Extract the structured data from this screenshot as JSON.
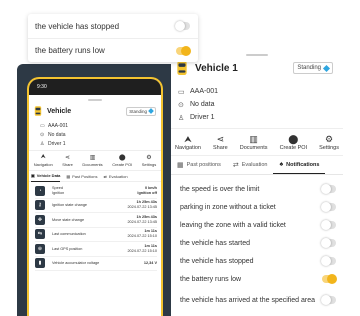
{
  "floating_card": {
    "items": [
      {
        "label": "the vehicle has stopped",
        "on": false
      },
      {
        "label": "the battery runs low",
        "on": true
      }
    ]
  },
  "phone": {
    "status_time": "9:30",
    "title": "Vehicle",
    "badge": "Standing",
    "info": [
      "AAA-001",
      "No data",
      "Driver 1"
    ],
    "actions": [
      {
        "label": "Navigation",
        "icon": "navigation-icon",
        "glyph": "⮝"
      },
      {
        "label": "Share",
        "icon": "share-icon",
        "glyph": "⋖"
      },
      {
        "label": "Documents",
        "icon": "documents-icon",
        "glyph": "▥"
      },
      {
        "label": "Create POI",
        "icon": "location-pin-icon",
        "glyph": "⬤"
      },
      {
        "label": "Settings",
        "icon": "gear-icon",
        "glyph": "⚙"
      }
    ],
    "tabs": [
      "Vehicle Data",
      "Past Positions",
      "Evaluation"
    ],
    "rows": [
      {
        "label": "Speed\nIgnition",
        "value1": "0 km/h",
        "value2": "Ignition off"
      },
      {
        "label": "Ignition state change",
        "value1": "1h 25m 43s",
        "value2": "2024.07.22 13:45"
      },
      {
        "label": "Move state change",
        "value1": "1h 25m 43s",
        "value2": "2024.07.22 13:45"
      },
      {
        "label": "Last communication",
        "value1": "1m 11s",
        "value2": "2024.07.22 15:10"
      },
      {
        "label": "Last GPS position",
        "value1": "1m 11s",
        "value2": "2024.07.22 15:10"
      },
      {
        "label": "Vehicle accumulator voltage",
        "value1": "12,34 V",
        "value2": ""
      }
    ]
  },
  "panel": {
    "title": "Vehicle 1",
    "badge": "Standing",
    "info": [
      "AAA-001",
      "No data",
      "Driver 1"
    ],
    "actions": [
      {
        "label": "Navigation",
        "icon": "navigation-icon",
        "glyph": "⮝"
      },
      {
        "label": "Share",
        "icon": "share-icon",
        "glyph": "⋖"
      },
      {
        "label": "Documents",
        "icon": "documents-icon",
        "glyph": "▥"
      },
      {
        "label": "Create POI",
        "icon": "location-pin-icon",
        "glyph": "⬤"
      },
      {
        "label": "Settings",
        "icon": "gear-icon",
        "glyph": "⚙"
      }
    ],
    "tabs": [
      {
        "label": "Past positions",
        "icon": "history-icon",
        "active": false
      },
      {
        "label": "Evaluation",
        "icon": "evaluation-icon",
        "active": false
      },
      {
        "label": "Notifications",
        "icon": "bell-icon",
        "active": true
      }
    ],
    "notifications": [
      {
        "label": "the speed is over the limit",
        "on": false
      },
      {
        "label": "parking in zone without a ticket",
        "on": false
      },
      {
        "label": "leaving the zone with a valid ticket",
        "on": false
      },
      {
        "label": "the vehicle has started",
        "on": false
      },
      {
        "label": "the vehicle has stopped",
        "on": false
      },
      {
        "label": "the battery runs low",
        "on": true
      },
      {
        "label": "the vehicle has arrived at the specified area",
        "on": false
      }
    ]
  },
  "colors": {
    "accent": "#f4c430",
    "dark": "#2d3945",
    "badge_blue": "#2fa6e0"
  }
}
